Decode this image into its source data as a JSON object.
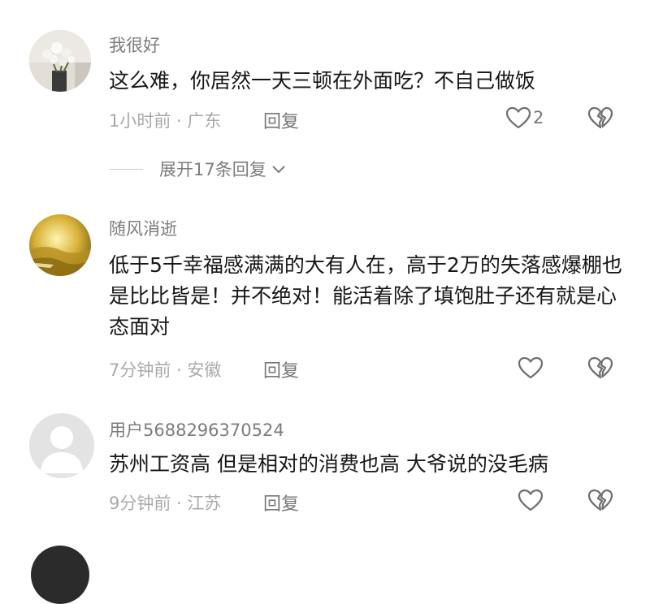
{
  "comments": [
    {
      "username": "我很好",
      "content": "这么难，你居然一天三顿在外面吃？不自己做饭",
      "time": "1小时前",
      "location": "广东",
      "reply_label": "回复",
      "likes": "2"
    },
    {
      "username": "随风消逝",
      "content": "低于5千幸福感满满的大有人在，高于2万的失落感爆棚也是比比皆是！并不绝对！能活着除了填饱肚子还有就是心态面对",
      "time": "7分钟前",
      "location": "安徽",
      "reply_label": "回复"
    },
    {
      "username": "用户5688296370524",
      "content": "苏州工资高 但是相对的消费也高 大爷说的没毛病",
      "time": "9分钟前",
      "location": "江苏",
      "reply_label": "回复"
    }
  ],
  "expand_replies": "展开17条回复",
  "meta_separator": " · "
}
